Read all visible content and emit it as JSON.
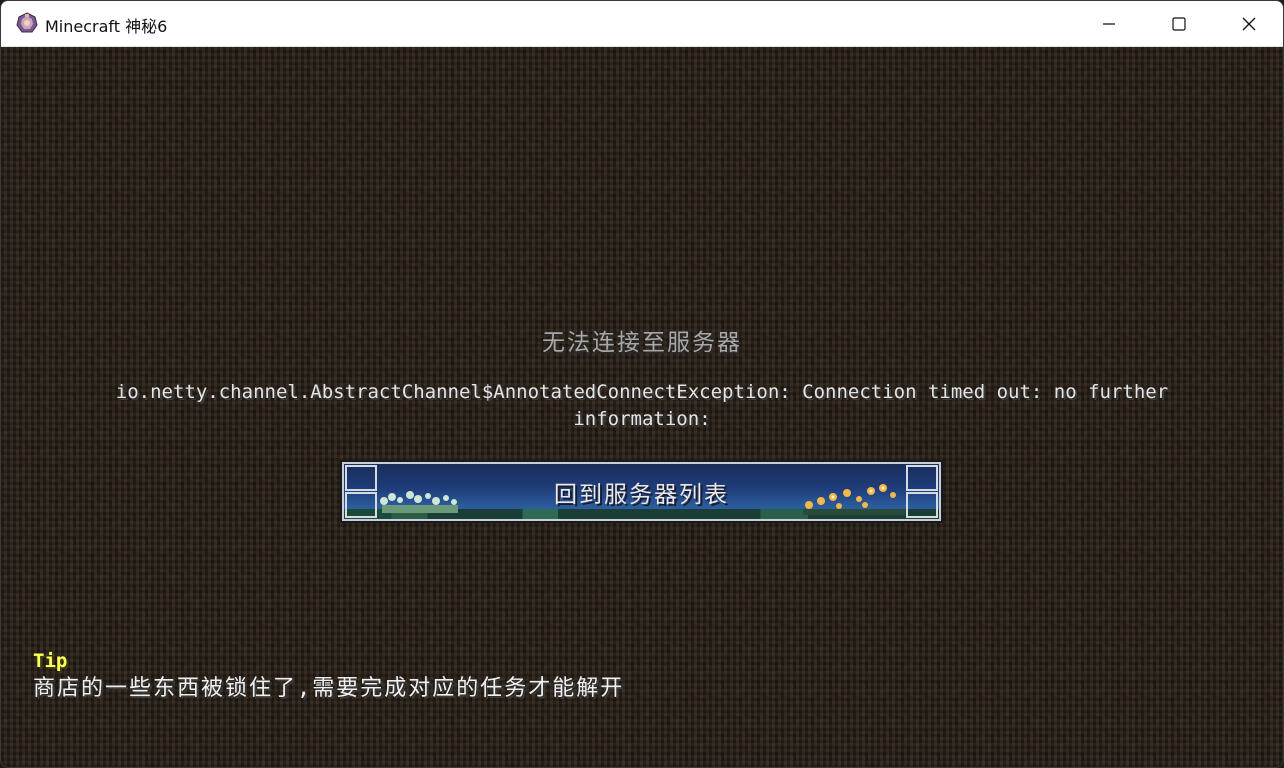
{
  "window": {
    "title": "Minecraft 神秘6",
    "app_icon": "minecraft-modpack-icon",
    "controls": {
      "minimize_icon": "minimize-icon",
      "maximize_icon": "maximize-icon",
      "close_icon": "close-icon"
    }
  },
  "screen": {
    "heading": "无法连接至服务器",
    "error_line_1": "io.netty.channel.AbstractChannel$AnnotatedConnectException: Connection timed out: no further",
    "error_line_2": "information:",
    "back_button_label": "回到服务器列表"
  },
  "tip": {
    "label": "Tip",
    "text": "商店的一些东西被锁住了,需要完成对应的任务才能解开"
  },
  "colors": {
    "heading": "#a8a8a8",
    "error_text": "#e4e4e4",
    "tip_label": "#ffff55",
    "tip_text": "#f0f0f0",
    "background": "#2b2219",
    "button_top": "#1a2d5a",
    "button_bottom": "#2d6aa5"
  }
}
